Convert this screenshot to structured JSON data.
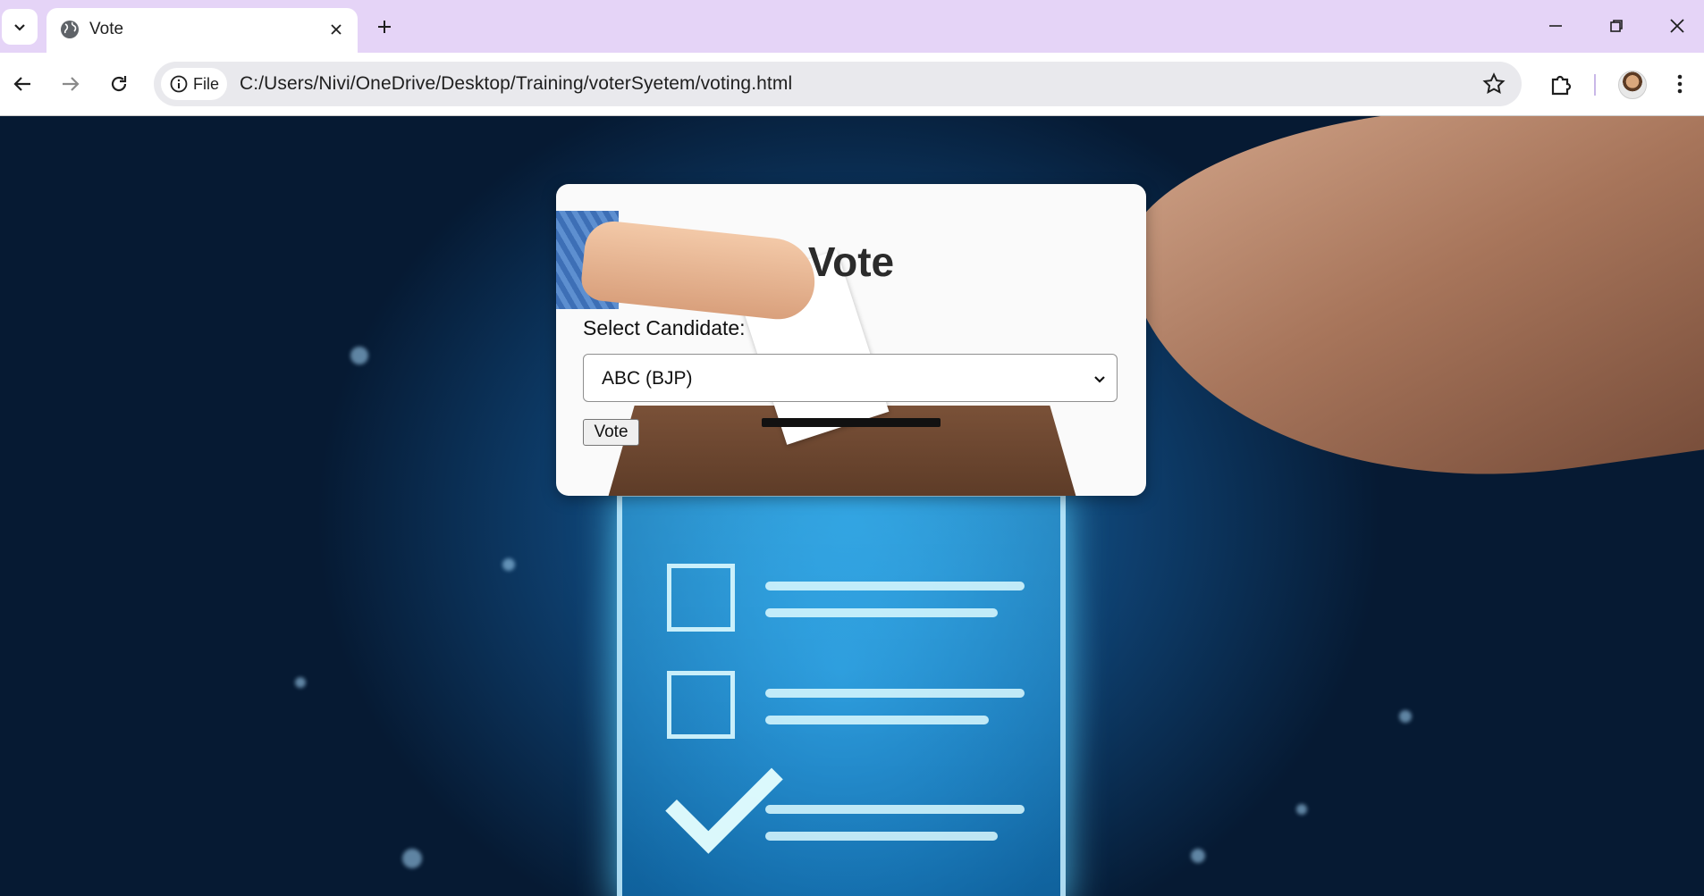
{
  "browser": {
    "tab_title": "Vote",
    "chip_label": "File",
    "url": "C:/Users/Nivi/OneDrive/Desktop/Training/voterSyetem/voting.html",
    "icons": {
      "tab_list": "chevron-down-icon",
      "tab_favicon": "globe-icon",
      "tab_close": "close-icon",
      "new_tab": "plus-icon",
      "minimize": "minimize-icon",
      "restore": "restore-icon",
      "close_window": "close-icon",
      "back": "arrow-left-icon",
      "forward": "arrow-right-icon",
      "reload": "reload-icon",
      "site_info": "info-icon",
      "bookmark": "star-icon",
      "extensions": "puzzle-icon",
      "menu": "kebab-icon"
    },
    "colors": {
      "tabbar": "#e5d4f7",
      "omnibox": "#e9e9ed"
    }
  },
  "page": {
    "title": "Vote",
    "select_label": "Select Candidate:",
    "selected_candidate": "ABC (BJP)",
    "vote_button": "Vote"
  }
}
